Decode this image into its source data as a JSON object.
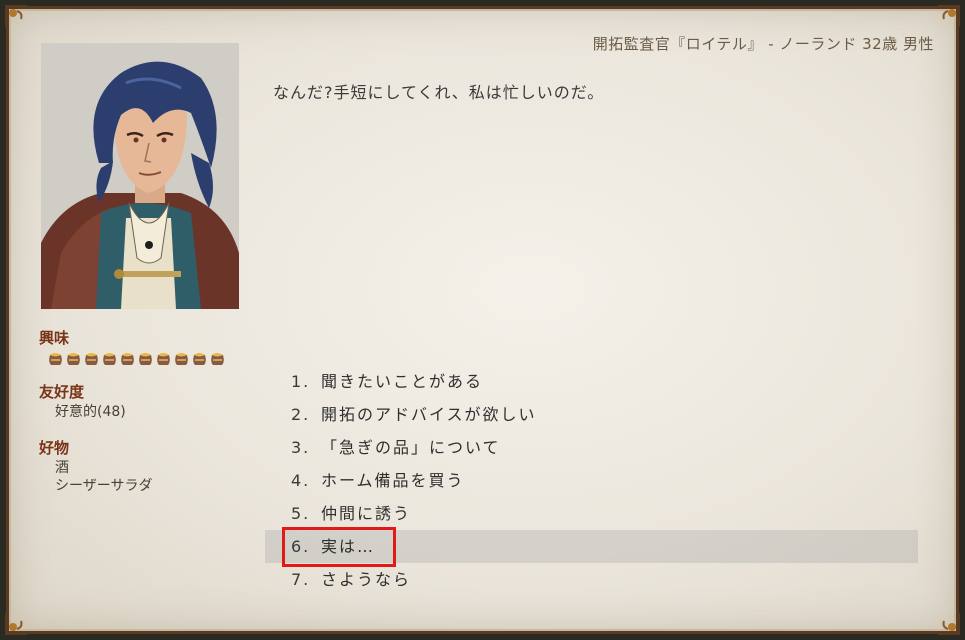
{
  "header": {
    "title": "開拓監査官『ロイテル』 - ノーランド 32歳 男性"
  },
  "portrait": {
    "subject": "blue-haired man in cloak"
  },
  "speech": "なんだ?手短にしてくれ、私は忙しいのだ。",
  "stats": {
    "interest_label": "興味",
    "interest_level": 10,
    "interest_icon": "honey-pot-icon",
    "friendship_label": "友好度",
    "friendship_value": "好意的(48)",
    "favorites_label": "好物",
    "favorites": [
      "酒",
      "シーザーサラダ"
    ]
  },
  "choices": [
    {
      "num": "1.",
      "label": "聞きたいことがある"
    },
    {
      "num": "2.",
      "label": "開拓のアドバイスが欲しい"
    },
    {
      "num": "3.",
      "label": "「急ぎの品」について"
    },
    {
      "num": "4.",
      "label": "ホーム備品を買う"
    },
    {
      "num": "5.",
      "label": "仲間に誘う"
    },
    {
      "num": "6.",
      "label": "実は…"
    },
    {
      "num": "7.",
      "label": "さようなら"
    }
  ],
  "selected_index": 5,
  "colors": {
    "frame": "#5b3a24",
    "paper": "#efebe3",
    "label_red": "#7a3418",
    "highlight_box": "#e01919"
  }
}
